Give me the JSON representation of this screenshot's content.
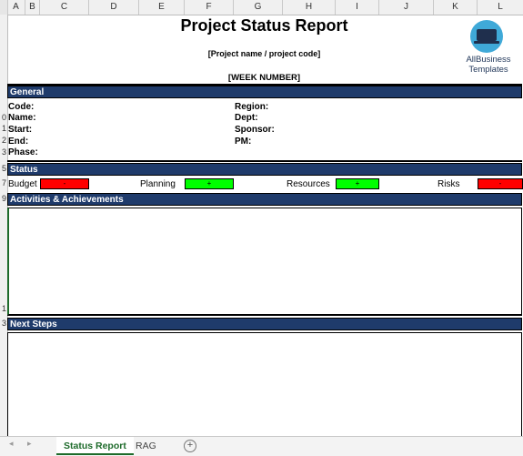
{
  "columns": [
    "A",
    "B",
    "C",
    "D",
    "E",
    "F",
    "G",
    "H",
    "I",
    "J",
    "K",
    "L"
  ],
  "rows": [
    "0",
    "1",
    "2",
    "3",
    "5",
    "7",
    "9",
    "1",
    "3"
  ],
  "report": {
    "title": "Project Status Report",
    "subtitle": "[Project name / project code]",
    "week": "[WEEK NUMBER]"
  },
  "logo": {
    "line1": "AllBusiness",
    "line2": "Templates",
    "icon": "laptop-icon"
  },
  "general": {
    "header": "General",
    "left": [
      "Code:",
      "Name:",
      "Start:",
      "End:",
      "Phase:"
    ],
    "right": [
      "Region:",
      "Dept:",
      "Sponsor:",
      "PM:"
    ]
  },
  "status": {
    "header": "Status",
    "items": [
      {
        "label": "Budget",
        "symbol": "-",
        "color": "#ff0000"
      },
      {
        "label": "Planning",
        "symbol": "+",
        "color": "#00ff00"
      },
      {
        "label": "Resources",
        "symbol": "+",
        "color": "#00ff00"
      },
      {
        "label": "Risks",
        "symbol": "-",
        "color": "#ff0000"
      }
    ]
  },
  "activities": {
    "header": "Activities & Achievements"
  },
  "next_steps": {
    "header": "Next Steps"
  },
  "tabs": [
    {
      "label": "Status Report",
      "active": true
    },
    {
      "label": "RAG",
      "active": false
    }
  ],
  "add_sheet": "+"
}
